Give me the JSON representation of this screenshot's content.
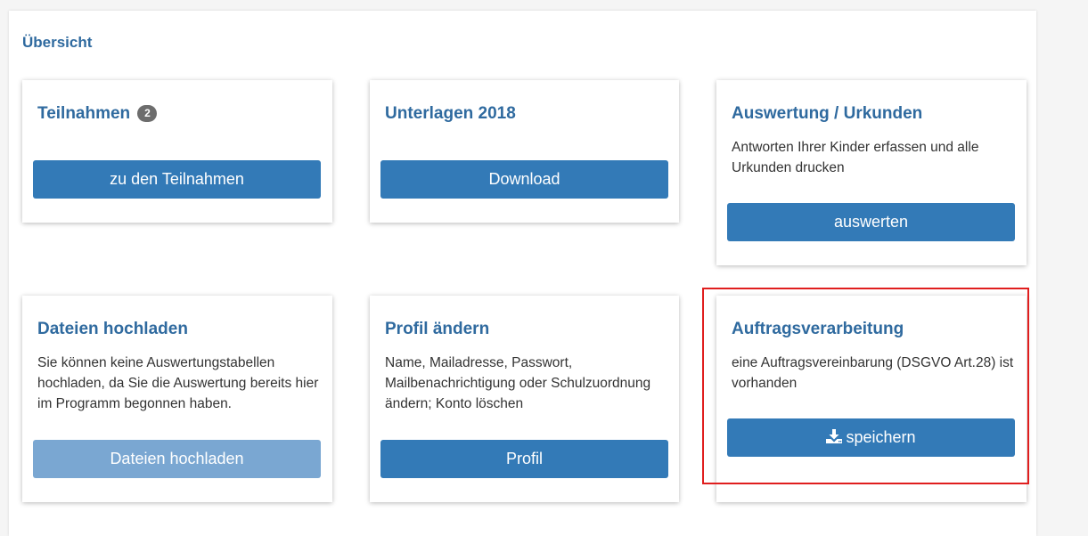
{
  "overview": {
    "title": "Übersicht"
  },
  "cards": {
    "teilnahmen": {
      "title": "Teilnahmen",
      "badge": "2",
      "button": "zu den Teilnahmen"
    },
    "unterlagen": {
      "title": "Unterlagen 2018",
      "button": "Download"
    },
    "auswertung": {
      "title": "Auswertung / Urkunden",
      "text": "Antworten Ihrer Kinder erfassen und alle Urkunden drucken",
      "button": "auswerten"
    },
    "dateien": {
      "title": "Dateien hochladen",
      "text": "Sie können keine Auswertungstabellen hochladen, da Sie die Auswertung bereits hier im Programm begonnen haben.",
      "button": "Dateien hochladen",
      "button_disabled": true
    },
    "profil": {
      "title": "Profil ändern",
      "text": "Name, Mailadresse, Passwort, Mailbenachrichtigung oder Schulzuordnung ändern; Konto löschen",
      "button": "Profil"
    },
    "auftrag": {
      "title": "Auftragsverarbeitung",
      "text": "eine Auftragsvereinbarung (DSGVO Art.28) ist vorhanden",
      "button": "speichern",
      "button_icon": "download-icon"
    }
  },
  "colors": {
    "title": "#2f6a9f",
    "button": "#337ab7",
    "button_disabled": "#7aa7d2",
    "highlight": "#e01e1e",
    "badge": "#6d6d6d"
  }
}
